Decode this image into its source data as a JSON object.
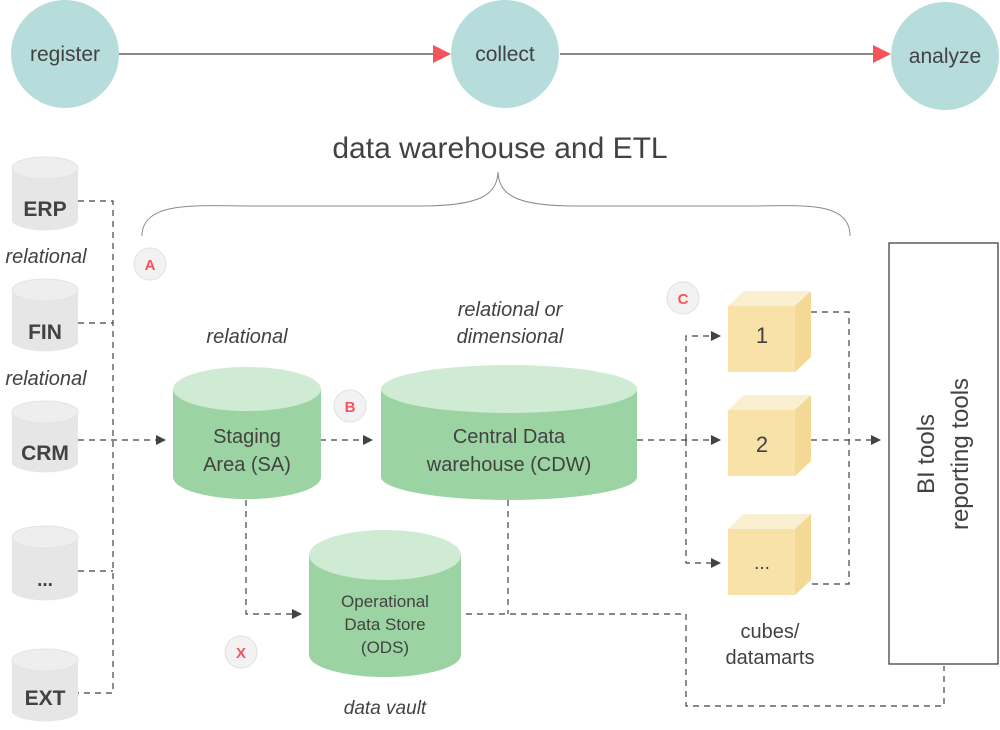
{
  "flow": {
    "steps": [
      {
        "label": "register"
      },
      {
        "label": "collect"
      },
      {
        "label": "analyze"
      }
    ],
    "circle_color": "#b7dcdc",
    "arrow_color": "#f4545a"
  },
  "title": "data warehouse and ETL",
  "sources": [
    {
      "label": "ERP",
      "caption": "relational"
    },
    {
      "label": "FIN",
      "caption": "relational"
    },
    {
      "label": "CRM",
      "caption": ""
    },
    {
      "label": "...",
      "caption": ""
    },
    {
      "label": "EXT",
      "caption": ""
    }
  ],
  "stores": {
    "staging": {
      "line1": "Staging",
      "line2": "Area (SA)",
      "caption": "relational"
    },
    "cdw": {
      "line1": "Central Data",
      "line2": "warehouse (CDW)",
      "caption1": "relational or",
      "caption2": "dimensional"
    },
    "ods": {
      "line1": "Operational",
      "line2": "Data Store",
      "line3": "(ODS)",
      "caption": "data vault"
    },
    "green": "#9bd4a2",
    "green_top": "#d0ebd3"
  },
  "cubes": {
    "items": [
      {
        "label": "1"
      },
      {
        "label": "2"
      },
      {
        "label": "..."
      }
    ],
    "caption1": "cubes/",
    "caption2": "datamarts",
    "color": "#f9e2a8"
  },
  "bi": {
    "line1": "BI tools",
    "line2": "reporting tools"
  },
  "markers": [
    {
      "label": "A"
    },
    {
      "label": "B"
    },
    {
      "label": "C"
    },
    {
      "label": "X"
    }
  ]
}
